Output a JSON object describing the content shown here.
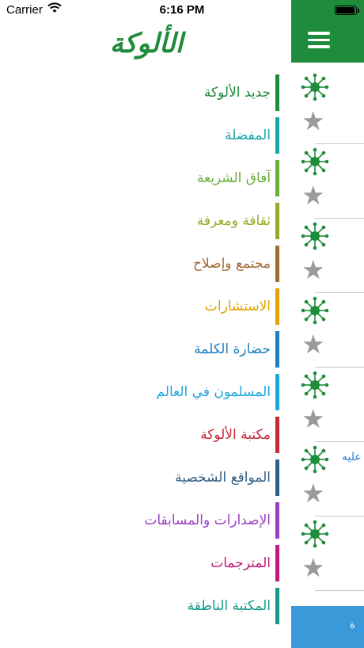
{
  "status_bar": {
    "carrier": "Carrier",
    "time": "6:16 PM",
    "battery_level": 1.0
  },
  "logo": {
    "text": "الألوكة",
    "color": "#1e8c3a"
  },
  "menu": {
    "items": [
      {
        "label": "جديد الألوكة",
        "color": "#1e8c3a"
      },
      {
        "label": "المفضلة",
        "color": "#1aa3a8"
      },
      {
        "label": "آفاق الشريعة",
        "color": "#6aae3a"
      },
      {
        "label": "ثقافة ومعرفة",
        "color": "#9aa826"
      },
      {
        "label": "مجتمع وإصلاح",
        "color": "#a06a32"
      },
      {
        "label": "الاستشارات",
        "color": "#e0a400"
      },
      {
        "label": "حضارة الكلمة",
        "color": "#1a7ec0"
      },
      {
        "label": "المسلمون في العالم",
        "color": "#1aa6df"
      },
      {
        "label": "مكتبة الألوكة",
        "color": "#c6283a"
      },
      {
        "label": "المواقع الشخصية",
        "color": "#2f5f86"
      },
      {
        "label": "الإصدارات والمسابقات",
        "color": "#9b3fc4"
      },
      {
        "label": "المترجمات",
        "color": "#c3187a"
      },
      {
        "label": "المكتبة الناطقة",
        "color": "#12998a"
      }
    ]
  },
  "right_panel": {
    "header_color": "#1e8c3a",
    "menu_icon": "hamburger-icon",
    "feed_icons": [
      "atom-icon",
      "star-icon"
    ],
    "snippet": "عليه",
    "bottom_text": "ة",
    "bottom_color": "#3a9ad9"
  }
}
